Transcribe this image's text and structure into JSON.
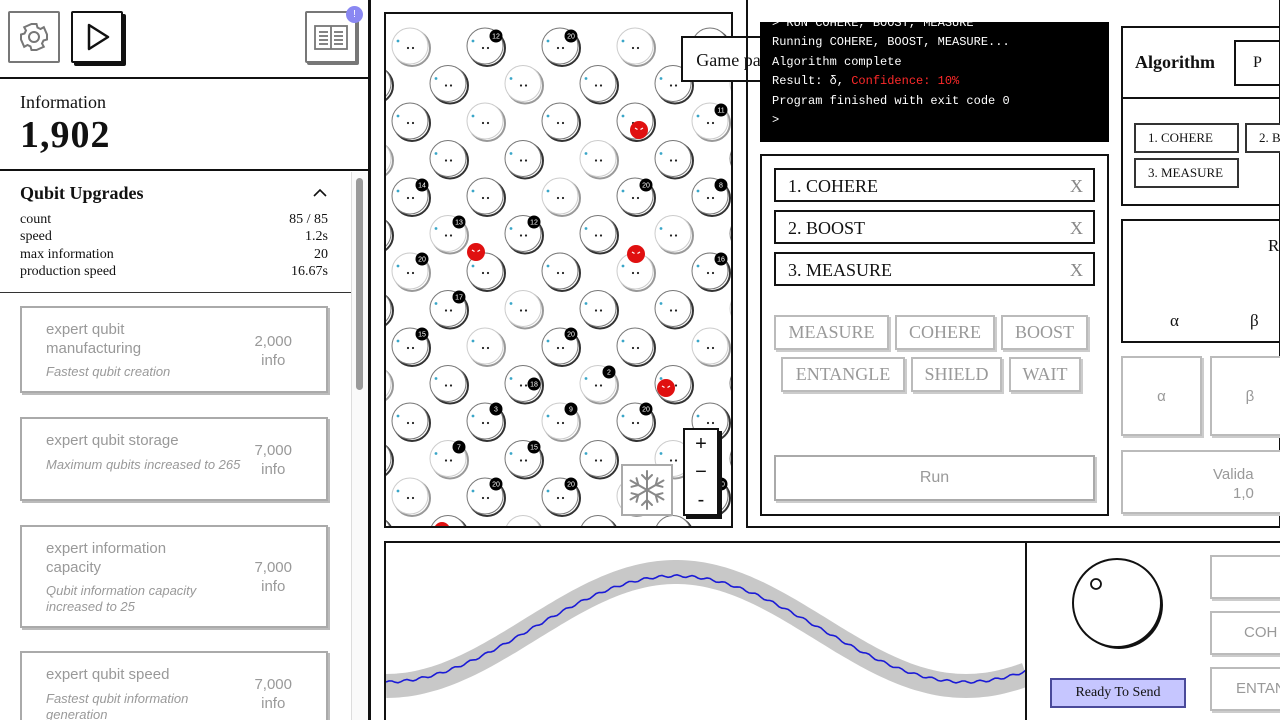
{
  "toolbar": {
    "settings_icon": "gear-icon",
    "play_icon": "play-icon",
    "book_icon": "book-icon",
    "notify_badge": "!"
  },
  "info": {
    "label": "Information",
    "value": "1,902"
  },
  "upgrades": {
    "title": "Qubit Upgrades",
    "stats": [
      {
        "label": "count",
        "value": "85 / 85"
      },
      {
        "label": "speed",
        "value": "1.2s"
      },
      {
        "label": "max information",
        "value": "20"
      },
      {
        "label": "production speed",
        "value": "16.67s"
      }
    ],
    "cards": [
      {
        "name": "expert qubit manufacturing",
        "desc": "Fastest qubit creation",
        "cost": "2,000",
        "unit": "info"
      },
      {
        "name": "expert qubit storage",
        "desc": "Maximum qubits increased to 265",
        "cost": "7,000",
        "unit": "info"
      },
      {
        "name": "expert information capacity",
        "desc": "Qubit information capacity increased to 25",
        "cost": "7,000",
        "unit": "info"
      },
      {
        "name": "expert qubit speed",
        "desc": "Fastest qubit information generation",
        "cost": "7,000",
        "unit": "info"
      }
    ]
  },
  "field": {
    "paused_label": "Game paused",
    "zoom_in": "+",
    "zoom_minus": "−",
    "zoom_out": "-",
    "freeze_icon": "snowflake-icon",
    "badge_labels": [
      "12",
      "20",
      "11",
      "14",
      "20",
      "8",
      "13",
      "12",
      "20",
      "16",
      "17",
      "15",
      "20",
      "18",
      "2",
      "20",
      "9",
      "3",
      "15",
      "7",
      "20",
      "20",
      "20"
    ]
  },
  "console": {
    "lines": [
      "> RUN COHERE, BOOST, MEASURE",
      "Running COHERE, BOOST, MEASURE...",
      "Algorithm complete",
      "Result: δ, ",
      "Program finished with exit code 0",
      ">"
    ],
    "confidence": "Confidence: 10%",
    "error_color": "#ff2a2a"
  },
  "program": {
    "slots": [
      {
        "label": "1.  COHERE",
        "remove": "X"
      },
      {
        "label": "2.  BOOST",
        "remove": "X"
      },
      {
        "label": "3.  MEASURE",
        "remove": "X"
      }
    ],
    "commands_row1": [
      "MEASURE",
      "COHERE",
      "BOOST"
    ],
    "commands_row2": [
      "ENTANGLE",
      "SHIELD",
      "WAIT"
    ],
    "run_label": "Run"
  },
  "algorithm": {
    "title": "Algorithm",
    "select_value": "P",
    "steps": [
      "1. COHERE",
      "2. B",
      "3. MEASURE"
    ]
  },
  "result_box": {
    "label": "R",
    "alpha": "α",
    "beta": "β"
  },
  "right_buttons": {
    "alpha": "α",
    "beta": "β",
    "validate": "Valida",
    "validate_value": "1,0"
  },
  "bottom": {
    "ready_label": "Ready To Send",
    "side_buttons": [
      "",
      "COH",
      "ENTAN"
    ],
    "wave_color": "#1a1ad6",
    "band_color": "#c8c8c8"
  }
}
